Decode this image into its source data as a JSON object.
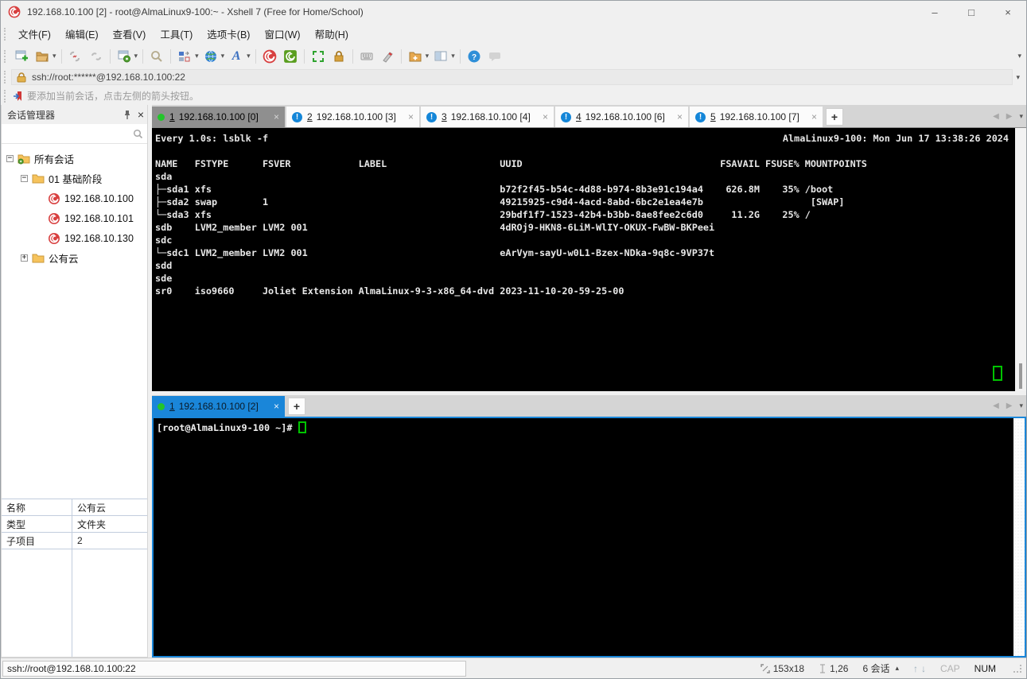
{
  "window": {
    "title": "192.168.10.100 [2] - root@AlmaLinux9-100:~ - Xshell 7 (Free for Home/School)",
    "controls": {
      "minimize": "–",
      "maximize": "□",
      "close": "×"
    }
  },
  "menu": {
    "items": [
      "文件(F)",
      "编辑(E)",
      "查看(V)",
      "工具(T)",
      "选项卡(B)",
      "窗口(W)",
      "帮助(H)"
    ]
  },
  "toolbar": {
    "icons": [
      "new-session",
      "open-session",
      "disconnect",
      "reconnect",
      "session-properties",
      "find",
      "arrange-layout",
      "encoding-globe",
      "font",
      "xshell",
      "xftp",
      "fullscreen",
      "lock-screen",
      "virtual-keyboard",
      "highlighter",
      "new-session-folder",
      "split-window",
      "help",
      "messages"
    ]
  },
  "address_bar": {
    "url": "ssh://root:******@192.168.10.100:22"
  },
  "info_bar": {
    "message": "要添加当前会话，点击左侧的箭头按钮。"
  },
  "glyphs": {
    "close": "×",
    "plus": "+",
    "minus": "−",
    "left_arrow": "◀",
    "right_arrow": "▶",
    "down_arrow": "▾",
    "up_triangle": "▴",
    "up_arrow": "↑",
    "down_arrow2": "↓"
  },
  "sidebar": {
    "title": "会话管理器",
    "tree": {
      "items": [
        {
          "label": "所有会话"
        },
        {
          "label": "01 基础阶段"
        },
        {
          "label": "192.168.10.100"
        },
        {
          "label": "192.168.10.101"
        },
        {
          "label": "192.168.10.130"
        },
        {
          "label": "公有云"
        }
      ]
    },
    "properties": {
      "rows": [
        {
          "label": "名称",
          "value": "公有云"
        },
        {
          "label": "类型",
          "value": "文件夹"
        },
        {
          "label": "子项目",
          "value": "2"
        }
      ]
    }
  },
  "pane1": {
    "tabs": [
      {
        "number": "1",
        "label": "192.168.10.100 [0]"
      },
      {
        "number": "2",
        "label": "192.168.10.100 [3]"
      },
      {
        "number": "3",
        "label": "192.168.10.100 [4]"
      },
      {
        "number": "4",
        "label": "192.168.10.100 [6]"
      },
      {
        "number": "5",
        "label": "192.168.10.100 [7]"
      }
    ],
    "terminal": {
      "watch_command": "Every 1.0s: lsblk -f",
      "host_time": "AlmaLinux9-100: Mon Jun 17 13:38:26 2024",
      "lines": [
        "",
        "NAME   FSTYPE      FSVER            LABEL                    UUID                                   FSAVAIL FSUSE% MOUNTPOINTS",
        "sda",
        "├─sda1 xfs                                                   b72f2f45-b54c-4d88-b974-8b3e91c194a4    626.8M    35% /boot",
        "├─sda2 swap        1                                         49215925-c9d4-4acd-8abd-6bc2e1ea4e7b                   [SWAP]",
        "└─sda3 xfs                                                   29bdf1f7-1523-42b4-b3bb-8ae8fee2c6d0     11.2G    25% /",
        "sdb    LVM2_member LVM2 001                                  4dROj9-HKN8-6LiM-WlIY-OKUX-FwBW-BKPeei",
        "sdc",
        "└─sdc1 LVM2_member LVM2 001                                  eArVym-sayU-w0L1-Bzex-NDka-9q8c-9VP37t",
        "sdd",
        "sde",
        "sr0    iso9660     Joliet Extension AlmaLinux-9-3-x86_64-dvd 2023-11-10-20-59-25-00"
      ]
    }
  },
  "pane2": {
    "tab": {
      "number": "1",
      "label": "192.168.10.100 [2]"
    },
    "terminal": {
      "prompt": "[root@AlmaLinux9-100 ~]# "
    }
  },
  "status_bar": {
    "connection": "ssh://root@192.168.10.100:22",
    "terminal_size": "153x18",
    "cursor_position": "1,26",
    "session_count": "6 会话",
    "caps_indicator": "CAP",
    "num_indicator": "NUM"
  },
  "colors": {
    "accent_blue": "#1a86d9",
    "session_red": "#d84040",
    "cursor_green": "#00c400",
    "alert_blue": "#1486d8"
  }
}
